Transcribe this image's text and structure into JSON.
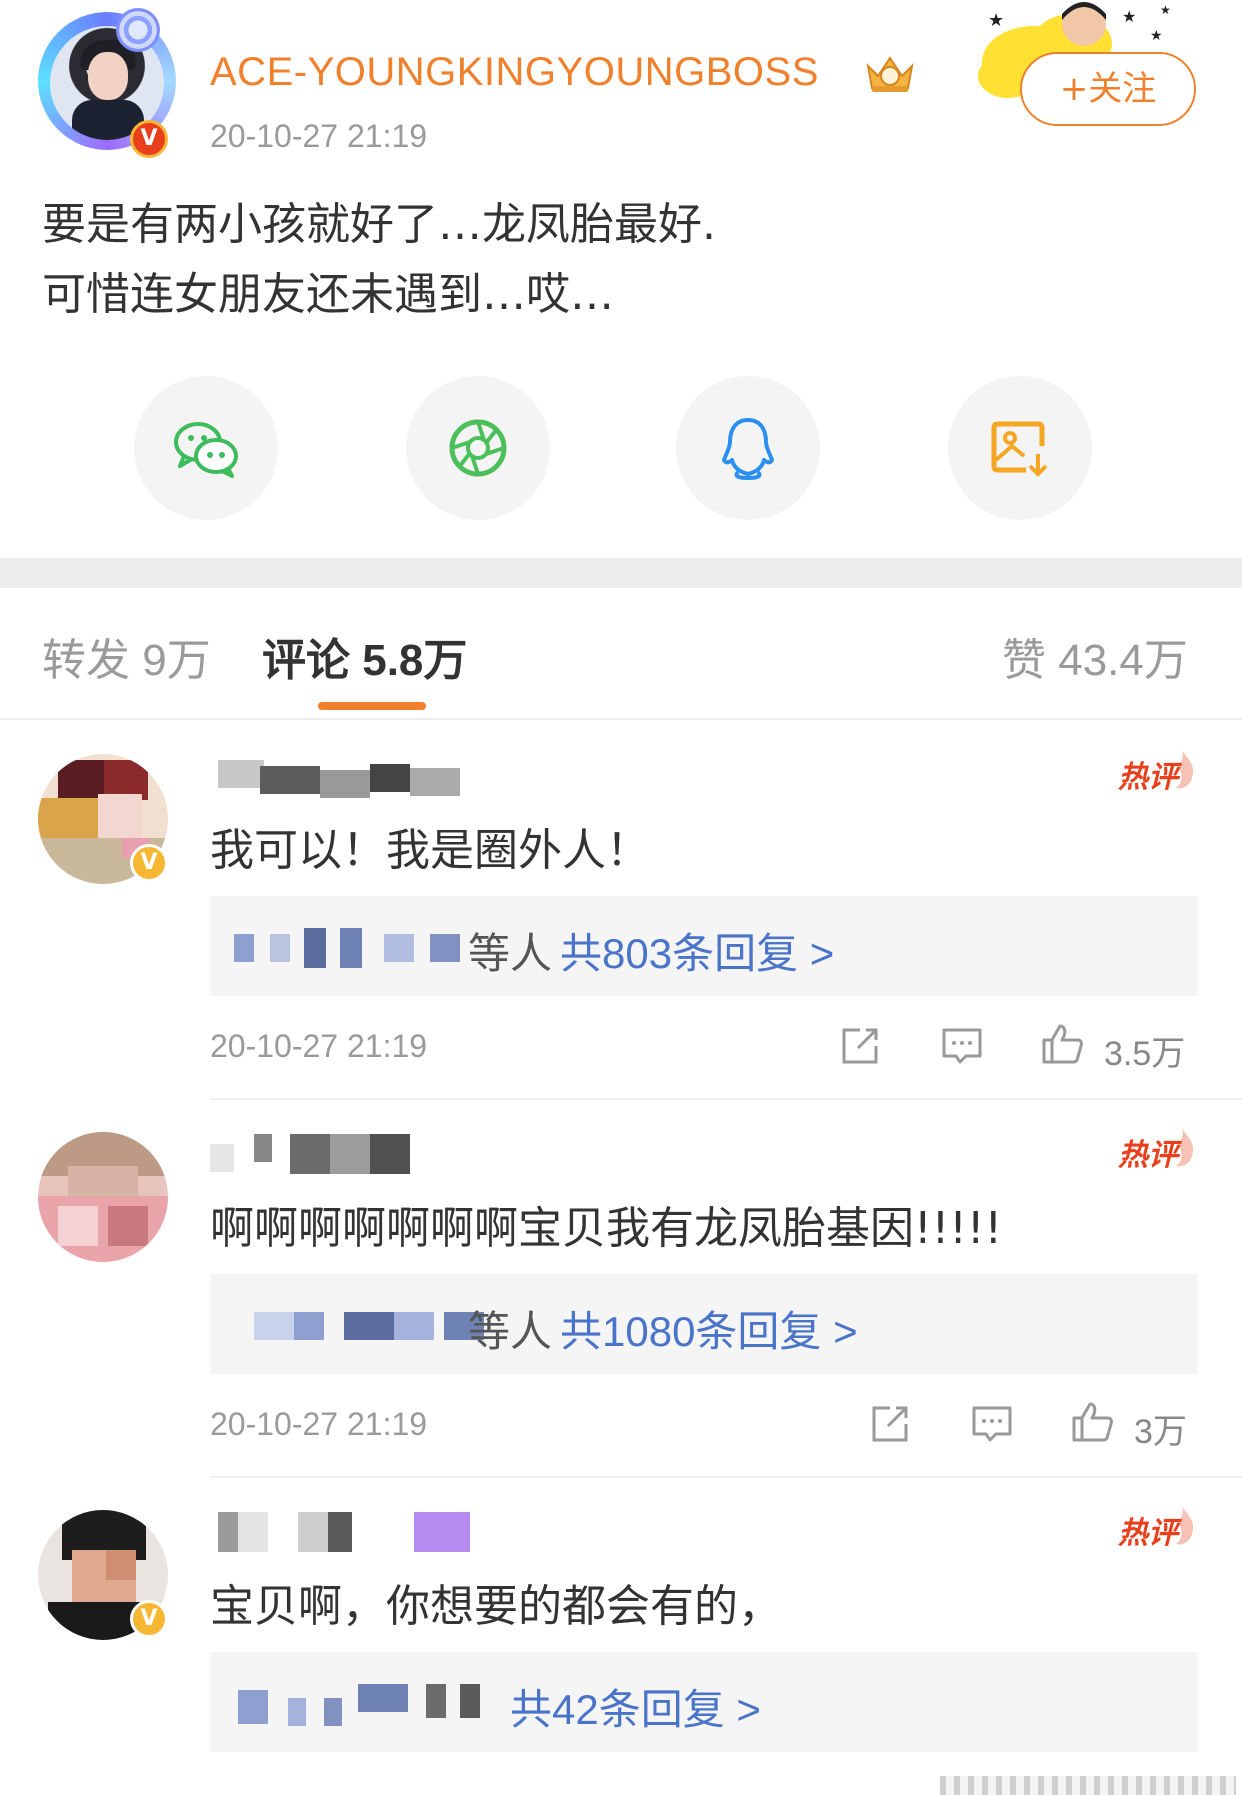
{
  "post": {
    "username": "ACE-YOUNGKINGYOUNGBOSS",
    "time": "20-10-27 21:19",
    "follow_label": "+关注",
    "text_line1": "要是有两小孩就好了…龙凤胎最好.",
    "text_line2": "可惜连女朋友还未遇到…哎…",
    "verified_badge": "V"
  },
  "share": [
    {
      "name": "wechat-icon",
      "color": "#3dbb5d"
    },
    {
      "name": "moments-icon",
      "color": "#4cbf5a"
    },
    {
      "name": "qq-icon",
      "color": "#2a8ff0"
    },
    {
      "name": "save-image-icon",
      "color": "#f5a623"
    }
  ],
  "tabs": {
    "repost": "转发 9万",
    "comments": "评论 5.8万",
    "likes": "赞 43.4万"
  },
  "comments": [
    {
      "text": "我可以！我是圈外人！",
      "hot_label": "热评",
      "reply_suffix": "等人",
      "reply_total": "共803条回复 >",
      "time": "20-10-27 21:19",
      "likes": "3.5万",
      "verified_badge": "V"
    },
    {
      "text": "啊啊啊啊啊啊啊宝贝我有龙凤胎基因!!!!!",
      "hot_label": "热评",
      "reply_suffix": "等人",
      "reply_total": "共1080条回复 >",
      "time": "20-10-27 21:19",
      "likes": "3万"
    },
    {
      "text": "宝贝啊，你想要的都会有的，",
      "hot_label": "热评",
      "reply_total": "共42条回复 >",
      "verified_badge": "V"
    }
  ],
  "colors": {
    "accent_orange": "#f0802c",
    "link_blue": "#4a74c9",
    "hot_red": "#e8401c"
  }
}
